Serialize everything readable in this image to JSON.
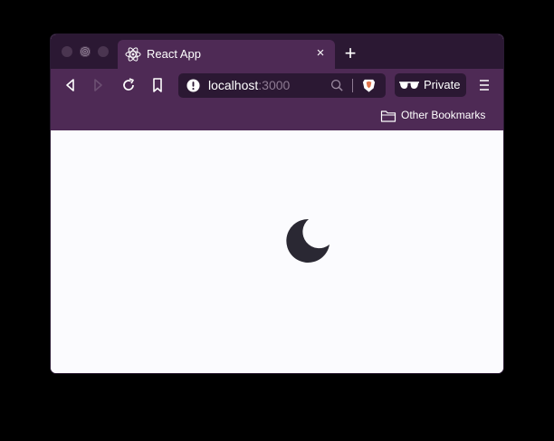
{
  "window": {
    "title_tab": {
      "title": "React App",
      "close_symbol": "×",
      "favicon": "react-icon"
    },
    "new_tab_symbol": "+"
  },
  "toolbar": {
    "back_icon": "back-icon",
    "forward_icon": "forward-icon",
    "reload_icon": "reload-icon",
    "bookmark_icon": "bookmark-icon",
    "url": {
      "host": "localhost",
      "port": ":3000"
    },
    "private_label": "Private",
    "menu_icon": "hamburger-menu-icon"
  },
  "bookmarks_bar": {
    "other_bookmarks": "Other Bookmarks"
  },
  "content": {
    "icon": "moon-icon"
  },
  "colors": {
    "titlebar": "#2b1833",
    "toolbar": "#4e2a55",
    "content_bg": "#fbfbfe",
    "moon": "#2a2833"
  }
}
